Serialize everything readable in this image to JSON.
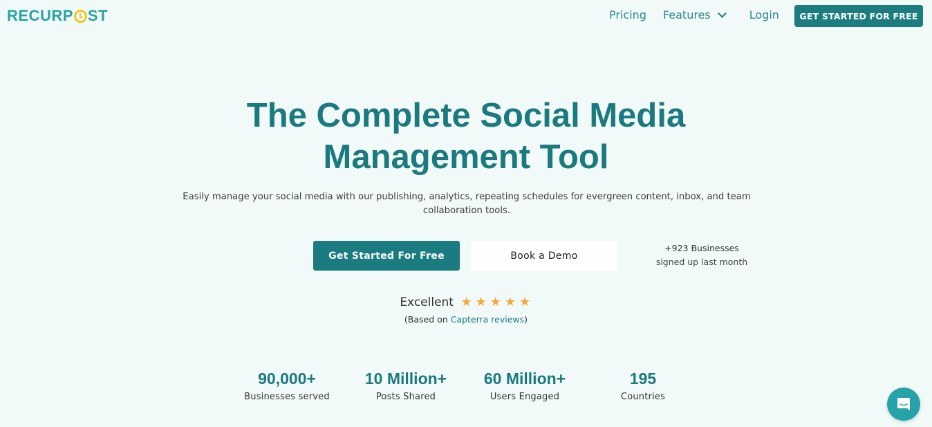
{
  "header": {
    "logo": {
      "part1": "RECURP",
      "part2": "ST"
    },
    "nav": [
      {
        "label": "Pricing"
      },
      {
        "label": "Features"
      },
      {
        "label": "Login"
      }
    ],
    "cta_label": "GET STARTED FOR FREE"
  },
  "hero": {
    "title_line1": "The Complete Social Media",
    "title_line2": "Management Tool",
    "subtitle_line1": "Easily manage your social media with our publishing, analytics, repeating schedules for evergreen content, inbox, and team",
    "subtitle_line2": "collaboration tools.",
    "primary_button": "Get Started For Free",
    "secondary_button": "Book a Demo",
    "signup_note_line1": "+923 Businesses",
    "signup_note_line2": "signed up last month"
  },
  "rating": {
    "label": "Excellent",
    "stars": 5,
    "star_glyph": "★",
    "source_prefix": "(Based on ",
    "source_link": "Capterra reviews",
    "source_suffix": ")"
  },
  "stats": [
    {
      "value": "90,000+",
      "label": "Businesses served"
    },
    {
      "value": "10 Million+",
      "label": "Posts Shared"
    },
    {
      "value": "60 Million+",
      "label": "Users Engaged"
    },
    {
      "value": "195",
      "label": "Countries"
    }
  ],
  "chat": {
    "icon": "chat-icon"
  },
  "colors": {
    "brand": "#1a7b80",
    "logo": "#28a3a4",
    "logo_accent": "#f5c425",
    "star": "#f2a93b",
    "background": "#f1f9f9"
  }
}
